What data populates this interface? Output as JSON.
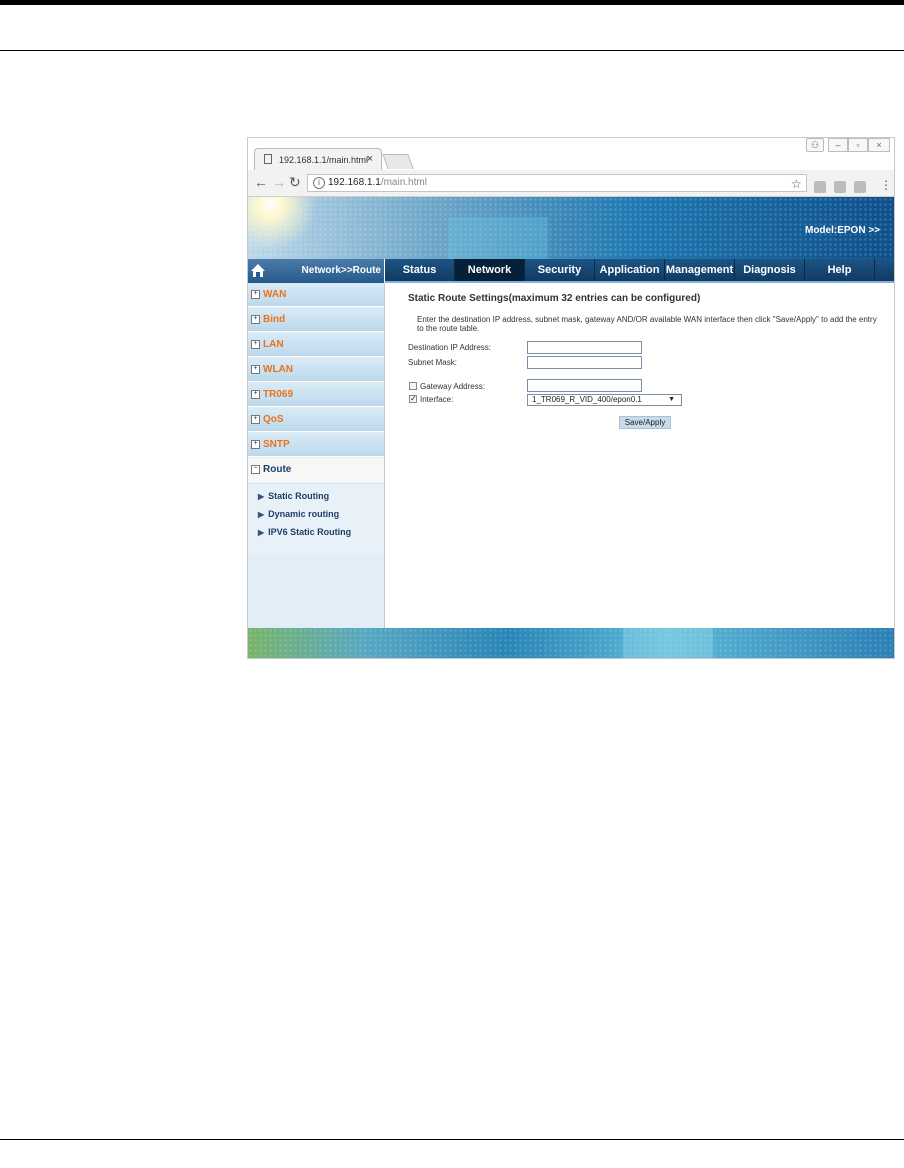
{
  "browser": {
    "tab_title": "192.168.1.1/main.html",
    "tab_close": "×",
    "url_host": "192.168.1.1",
    "url_path": "/main.html",
    "window_controls": [
      "–",
      "▫",
      "×"
    ]
  },
  "banner": {
    "model": "Model:EPON >>"
  },
  "sidebar": {
    "breadcrumb": "Network>>Route",
    "items": [
      {
        "label": "WAN"
      },
      {
        "label": "Bind"
      },
      {
        "label": "LAN"
      },
      {
        "label": "WLAN"
      },
      {
        "label": "TR069"
      },
      {
        "label": "QoS"
      },
      {
        "label": "SNTP"
      },
      {
        "label": "Route"
      }
    ],
    "subitems": [
      {
        "label": "Static Routing"
      },
      {
        "label": "Dynamic routing"
      },
      {
        "label": "IPV6 Static Routing"
      }
    ]
  },
  "nav": {
    "tabs": [
      "Status",
      "Network",
      "Security",
      "Application",
      "Management",
      "Diagnosis",
      "Help"
    ],
    "active": "Network"
  },
  "form": {
    "title": "Static Route Settings(maximum 32 entries can be configured)",
    "description": "Enter the destination IP address, subnet mask, gateway AND/OR available WAN interface then click \"Save/Apply\" to add the entry to the route table.",
    "dest_label": "Destination IP Address:",
    "dest_value": "",
    "mask_label": "Subnet Mask:",
    "mask_value": "",
    "gateway_label": "Gateway Address:",
    "gateway_checked": false,
    "gateway_value": "",
    "interface_label": "Interface:",
    "interface_checked": true,
    "interface_value": "1_TR069_R_VID_400/epon0.1",
    "save_label": "Save/Apply"
  },
  "colors": {
    "nav_bg": "#103b63",
    "sidebar_text": "#e8731a",
    "active_tab_bg": "#07203a"
  },
  "icons": [
    "page-icon",
    "back-arrow-icon",
    "forward-arrow-icon",
    "reload-icon",
    "info-icon",
    "star-icon",
    "house-icon",
    "expand-plus-icon",
    "triangle-right-icon",
    "checkbox-icon",
    "dropdown-arrow-icon",
    "menu-dots-icon"
  ]
}
